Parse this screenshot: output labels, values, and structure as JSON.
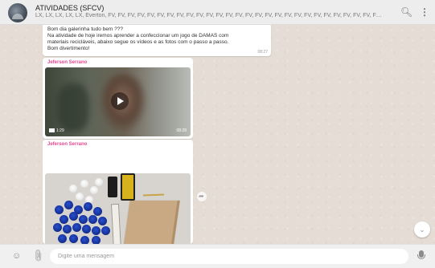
{
  "header": {
    "title": "ATIVIDADES (SFCV)",
    "members": "LX, LX, LX, LX, LX, Everton, FV, FV, FV, FV, FV, FV, FV, FV, FV, FV, FV, FV, FV, FV, FV, FV, FV, FV, FV, FV, FV, FV, FV, FV, FV, FV, FV, FV, FV, FV, FV, FV, ...",
    "search_icon": "search-icon",
    "menu_icon": "more-vertical-icon"
  },
  "messages": [
    {
      "lines": [
        "Bom dia galerinha tudo bem ???",
        "Na atividade de hoje iremos aprender a confeccionar um jogo de DAMAS com",
        "materiais recicláveis, abaixo segue os vídeos e as fotos com o passo a passo.",
        "Bom divertimento!"
      ],
      "time": "08:27"
    },
    {
      "sender": "Jeferson Serrano",
      "video_duration": "1:29",
      "time": "08:28"
    },
    {
      "sender": "Jeferson Serrano"
    }
  ],
  "footer": {
    "placeholder": "Digite uma mensagem",
    "emoji_icon": "emoji-icon",
    "attach_icon": "paperclip-icon",
    "mic_icon": "microphone-icon"
  },
  "colors": {
    "header_bg": "#ededed",
    "chat_bg": "#e5ddd5",
    "sender_name": "#e54792",
    "footer_bg": "#f0f0f0"
  }
}
